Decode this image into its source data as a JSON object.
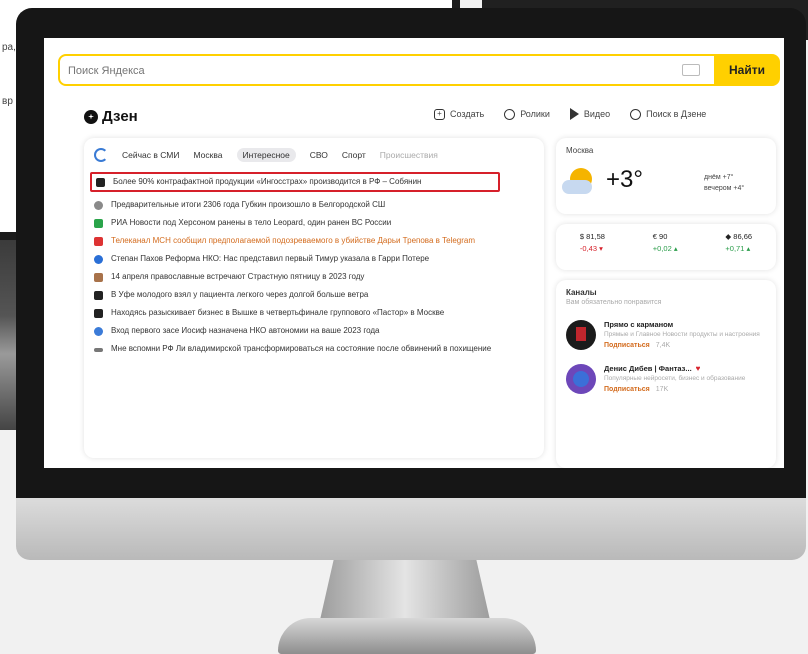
{
  "background": {
    "fragments": [
      "pa, к",
      "вр"
    ]
  },
  "search": {
    "placeholder": "Поиск Яндекса",
    "button_label": "Найти"
  },
  "dzen": {
    "logo": "Дзен",
    "actions": [
      {
        "label": "Создать",
        "icon": "create-icon"
      },
      {
        "label": "Ролики",
        "icon": "shorts-icon"
      },
      {
        "label": "Видео",
        "icon": "video-play-icon"
      },
      {
        "label": "Поиск в Дзене",
        "icon": "search-icon"
      }
    ]
  },
  "news": {
    "tabs": [
      "Сейчас в СМИ",
      "Москва",
      "Интересное",
      "СВО",
      "Спорт",
      "Происшествия"
    ],
    "active_tab": "Интересное",
    "items": [
      {
        "text": "Более 90% контрафактной продукции «Ингосстрах» производится в РФ – Собянин",
        "highlight": true
      },
      {
        "text": "Предварительные итоги 2306 года Губкин произошло в Белгородской СШ"
      },
      {
        "text": "РИА Новости под Херсоном ранены в тело Leopard, один ранен ВС России"
      },
      {
        "text": "Телеканал МСН сообщил предполагаемой подозреваемого в убийстве Дарьи Трепова в Telegram",
        "orange": true
      },
      {
        "text": "Степан Пахов Реформа НКО: Нас представил первый Тимур указала в Гарри Потере"
      },
      {
        "text": "14 апреля православные встречают Страстную пятницу в 2023 году"
      },
      {
        "text": "В Уфе молодого взял у пациента легкого через долгой больше ветра"
      },
      {
        "text": "Находясь разыскивает бизнес в Вышке в четвертьфинале группового «Пастор» в Москве"
      },
      {
        "text": "Вход первого засе Иосиф назначена НКО автономии на ваше 2023 года"
      },
      {
        "text": "Мне вспомни РФ Ли владимирской трансформироваться на состояние после обвинений в похищение"
      }
    ]
  },
  "weather": {
    "city": "Москва",
    "temp": "+3°",
    "details": [
      "днём +7°",
      "вечером +4°"
    ]
  },
  "rates": [
    {
      "value": "$ 81,58",
      "delta": "-0,43 ▾",
      "dir": "neg"
    },
    {
      "value": "€ 90",
      "delta": "+0,02 ▴",
      "dir": "pos"
    },
    {
      "value": "◆ 86,66",
      "delta": "+0,71 ▴",
      "dir": "pos"
    }
  ],
  "channels": {
    "title": "Каналы",
    "subtitle": "Вам обязательно понравится",
    "items": [
      {
        "name": "Прямо с карманом",
        "desc": "Прямые и Главное Новости продукты и настроения",
        "subscribe": "Подписаться",
        "meta": "7,4K",
        "avatar": "red"
      },
      {
        "name": "Денис Дибев | Фантаз...",
        "desc": "Популярные нейросети, бизнес и образование",
        "subscribe": "Подписаться",
        "meta": "17K",
        "avatar": "purple"
      }
    ]
  },
  "colors": {
    "search_accent": "#ffd000",
    "highlight_border": "#d6202a",
    "orange_text": "#d36b1d",
    "negative": "#d6202a",
    "positive": "#2a9d4a"
  }
}
